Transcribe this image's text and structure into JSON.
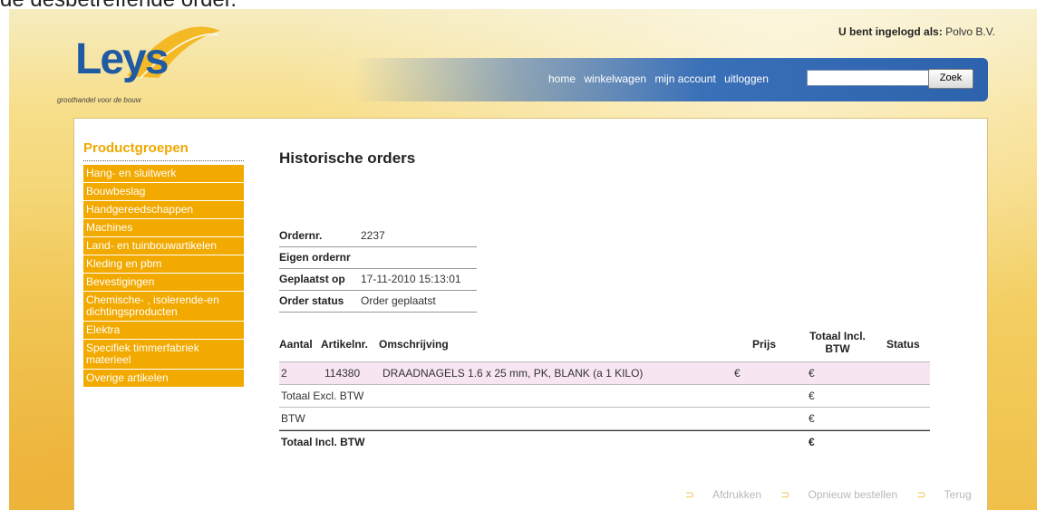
{
  "doc_fragment": "de desbetreffende order.",
  "header": {
    "logo_text": "Leys",
    "logo_tagline": "groothandel voor de bouw",
    "login_label": "U bent ingelogd als:",
    "login_user": "Polvo B.V."
  },
  "nav": {
    "home": "home",
    "cart": "winkelwagen",
    "account": "mijn account",
    "logout": "uitloggen",
    "search_value": "",
    "search_button": "Zoek"
  },
  "sidebar": {
    "title": "Productgroepen",
    "items": [
      {
        "label": "Hang- en sluitwerk"
      },
      {
        "label": "Bouwbeslag"
      },
      {
        "label": "Handgereedschappen"
      },
      {
        "label": "Machines"
      },
      {
        "label": "Land- en tuinbouwartikelen"
      },
      {
        "label": "Kleding en pbm"
      },
      {
        "label": "Bevestigingen"
      },
      {
        "label": "Chemische- , isolerende-en dichtingsproducten"
      },
      {
        "label": "Elektra"
      },
      {
        "label": "Specifiek timmerfabriek materieel"
      },
      {
        "label": "Overige artikelen"
      }
    ]
  },
  "main": {
    "title": "Historische orders",
    "meta": [
      {
        "label": "Ordernr.",
        "value": "2237"
      },
      {
        "label": "Eigen ordernr",
        "value": ""
      },
      {
        "label": "Geplaatst op",
        "value": "17-11-2010 15:13:01"
      },
      {
        "label": "Order status",
        "value": "Order geplaatst"
      }
    ],
    "table": {
      "headers": {
        "qty": "Aantal",
        "artno": "Artikelnr.",
        "desc": "Omschrijving",
        "price": "Prijs",
        "total": "Totaal Incl. BTW",
        "status": "Status"
      },
      "rows": [
        {
          "qty": "2",
          "artno": "114380",
          "desc": "DRAADNAGELS 1.6 x 25 mm, PK, BLANK (a 1 KILO)",
          "price": "€",
          "total": "€"
        }
      ],
      "summary": [
        {
          "label": "Totaal Excl. BTW",
          "value": "€"
        },
        {
          "label": "BTW",
          "value": "€"
        },
        {
          "label": "Totaal Incl. BTW",
          "value": "€"
        }
      ]
    },
    "actions": {
      "print": "Afdrukken",
      "reorder": "Opnieuw bestellen",
      "back": "Terug"
    }
  }
}
